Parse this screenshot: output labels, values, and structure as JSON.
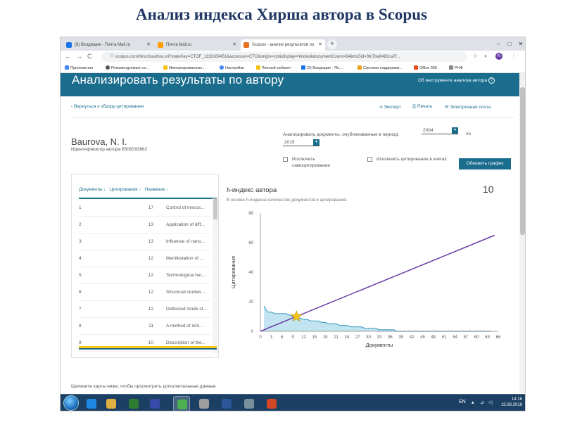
{
  "slide_title": "Анализ индекса Хирша автора в Scopus",
  "browser": {
    "tabs": [
      {
        "label": "(8) Входящие - Почта Mail.ru",
        "fav_color": "#1a73e8"
      },
      {
        "label": "Почта Mail.ru",
        "fav_color": "#ff9e00"
      },
      {
        "label": "Scopus - анализ результатов по",
        "fav_color": "#e9711c"
      }
    ],
    "new_tab": "+",
    "window_buttons": [
      "–",
      "□",
      "✕"
    ],
    "nav": {
      "back": "←",
      "forward": "→",
      "reload": "C",
      "lock": "ⓘ"
    },
    "url": "scopus.com/hirsch/author.uri?stateKey=CTOF_1119169451&accessor=CTO&origin=cto&display=hIndex&documentCount=64&trsGid=3fc7be8482ca7f...",
    "right_icons": {
      "star": "☆",
      "profile": "N",
      "menu": "⋮",
      "ext": "◐"
    },
    "bookmarks": [
      {
        "label": "Приложения",
        "color": "#4285f4"
      },
      {
        "label": "Рекомендуемые са...",
        "color": "#555555"
      },
      {
        "label": "Импортированные...",
        "color": "#f4c20d"
      },
      {
        "label": "Настройки",
        "color": "#4285f4"
      },
      {
        "label": "Личный кабинет",
        "color": "#f4c20d"
      },
      {
        "label": "(2) Входящие - По...",
        "color": "#1a73e8"
      },
      {
        "label": "Система поддержки...",
        "color": "#e8a317"
      },
      {
        "label": "Office 365",
        "color": "#e64a19"
      },
      {
        "label": "РНФ",
        "color": "#888888"
      }
    ]
  },
  "page": {
    "banner_title": "Анализировать результаты по автору",
    "about_tool": "Об инструменте анализа автора",
    "about_icon": "?",
    "back_link": "‹ Вернуться к обзору цитирования",
    "actions": {
      "export": "Экспорт",
      "print": "Печать",
      "email": "Электронная почта"
    },
    "author_name": "Baurova, N. I.",
    "author_id": "Идентификатор автора 6508293862",
    "period_label": "Анализировать документы, опубликованные в период:",
    "period_from": "2004",
    "period_to": "2019",
    "period_sep": "по",
    "exclude_self": "Исключить самоцитирование",
    "exclude_books": "Исключить цитирование в книгах",
    "refresh_button": "Обновить график",
    "hint": "Щелкните карты ниже, чтобы просмотреть дополнительные данные"
  },
  "table": {
    "headers": [
      "Документы ↓",
      "Цитирования ↓",
      "Название ↓"
    ],
    "rows": [
      {
        "n": "1",
        "c": "17",
        "t": "Control of micros..."
      },
      {
        "n": "2",
        "c": "13",
        "t": "Application of diff..."
      },
      {
        "n": "3",
        "c": "13",
        "t": "Influence of nano..."
      },
      {
        "n": "4",
        "c": "12",
        "t": "Manifestation of ..."
      },
      {
        "n": "5",
        "c": "12",
        "t": "Technological her..."
      },
      {
        "n": "6",
        "c": "12",
        "t": "Structural studies ..."
      },
      {
        "n": "7",
        "c": "12",
        "t": "Deflected mode st..."
      },
      {
        "n": "8",
        "c": "11",
        "t": "A method of imit..."
      },
      {
        "n": "9",
        "c": "10",
        "t": "Description of the..."
      }
    ]
  },
  "hindex": {
    "title_prefix": "h",
    "title_rest": "-индекс автора",
    "value": "10",
    "subtitle_a": "В основе ",
    "subtitle_h": "h",
    "subtitle_b": "-индекса количество документов и цитирований."
  },
  "chart_data": {
    "type": "area",
    "xlabel": "Документы",
    "ylabel": "Цитирования",
    "xlim": [
      0,
      66
    ],
    "ylim": [
      0,
      80
    ],
    "xticks": [
      0,
      3,
      6,
      9,
      12,
      15,
      18,
      21,
      24,
      27,
      30,
      33,
      36,
      39,
      42,
      45,
      48,
      51,
      54,
      57,
      60,
      63,
      66
    ],
    "yticks": [
      0,
      20,
      40,
      60,
      80
    ],
    "citations": [
      17,
      13,
      13,
      12,
      12,
      12,
      12,
      11,
      10,
      9,
      9,
      8,
      8,
      7,
      7,
      7,
      6,
      6,
      5,
      5,
      5,
      4,
      4,
      4,
      3,
      3,
      3,
      3,
      2,
      2,
      2,
      2,
      1,
      1,
      1,
      1,
      1,
      0,
      0,
      0,
      0,
      0,
      0,
      0,
      0,
      0,
      0,
      0,
      0,
      0,
      0,
      0,
      0,
      0,
      0,
      0,
      0,
      0,
      0,
      0,
      0,
      0,
      0,
      0
    ],
    "diagonal": {
      "x": [
        0,
        65
      ],
      "y": [
        0,
        65
      ]
    },
    "h_point": {
      "x": 10,
      "y": 10
    },
    "colors": {
      "area": "#a8d8ea",
      "line": "#4aa3c7",
      "diagonal": "#6a3ba5",
      "star": "#f5c518",
      "axis": "#888888"
    }
  },
  "taskbar": {
    "apps": [
      {
        "name": "ie",
        "color": "#1e88e5"
      },
      {
        "name": "explorer",
        "color": "#e0b040"
      },
      {
        "name": "media",
        "color": "#2e7d32"
      },
      {
        "name": "save",
        "color": "#3949ab"
      },
      {
        "name": "chrome",
        "color": "#4caf50"
      },
      {
        "name": "tool",
        "color": "#9e9e9e"
      },
      {
        "name": "word",
        "color": "#2b579a"
      },
      {
        "name": "app",
        "color": "#78909c"
      },
      {
        "name": "powerpoint",
        "color": "#d24726"
      }
    ],
    "lang": "EN",
    "time": "14:16",
    "date": "15.08.2019"
  }
}
